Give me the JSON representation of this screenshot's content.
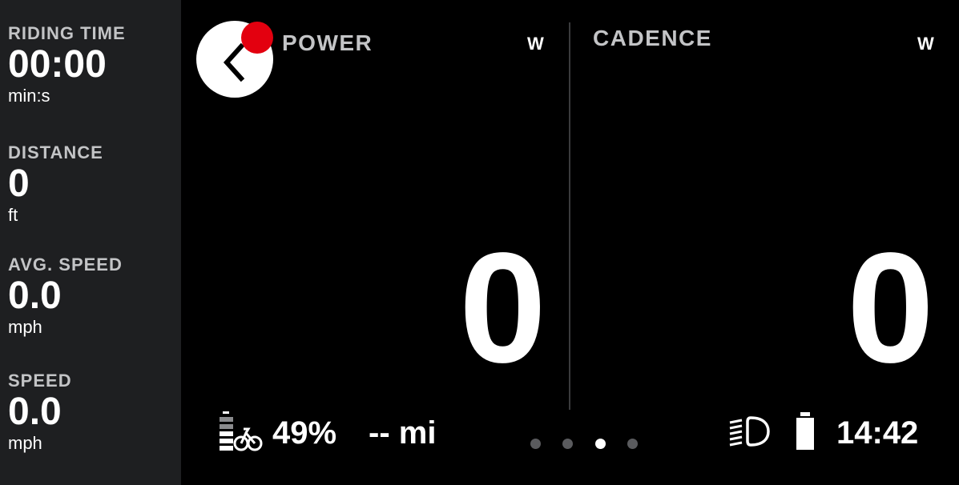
{
  "sidebar": {
    "stats": [
      {
        "label": "RIDING TIME",
        "value": "00:00",
        "unit": "min:s"
      },
      {
        "label": "DISTANCE",
        "value": "0",
        "unit": "ft"
      },
      {
        "label": "AVG. SPEED",
        "value": "0.0",
        "unit": "mph"
      },
      {
        "label": "SPEED",
        "value": "0.0",
        "unit": "mph"
      }
    ]
  },
  "panels": [
    {
      "title": "POWER",
      "unit": "W",
      "value": "0"
    },
    {
      "title": "CADENCE",
      "unit": "W",
      "value": "0"
    }
  ],
  "status": {
    "battery_percent": "49%",
    "range": "-- mi",
    "clock": "14:42"
  },
  "pagination": {
    "total": 4,
    "active_index": 2
  },
  "colors": {
    "sidebar_bg": "#1e1f21",
    "notification": "#e3000f",
    "label_gray": "#c3c4c6"
  },
  "icons": {
    "back": "chevron-left-icon",
    "battery_bike": "ebike-battery-icon",
    "headlight": "headlight-icon",
    "battery": "battery-icon"
  }
}
